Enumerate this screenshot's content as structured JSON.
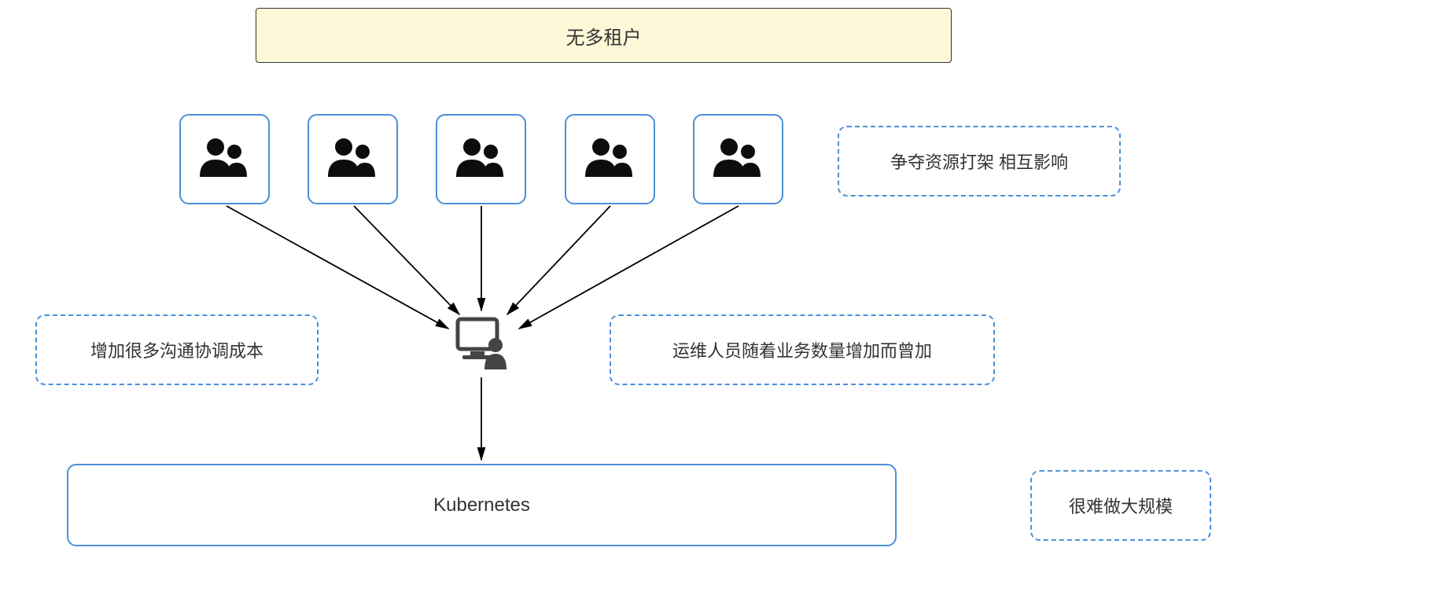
{
  "title": "无多租户",
  "users": [
    {
      "id": "user-1"
    },
    {
      "id": "user-2"
    },
    {
      "id": "user-3"
    },
    {
      "id": "user-4"
    },
    {
      "id": "user-5"
    }
  ],
  "admin": {
    "label": "admin-operator"
  },
  "kubernetes": {
    "label": "Kubernetes"
  },
  "annotations": {
    "resource_contention": "争夺资源打架 相互影响",
    "communication_cost": "增加很多沟通协调成本",
    "ops_scaling": "运维人员随着业务数量增加而曾加",
    "hard_to_scale": "很难做大规模"
  }
}
